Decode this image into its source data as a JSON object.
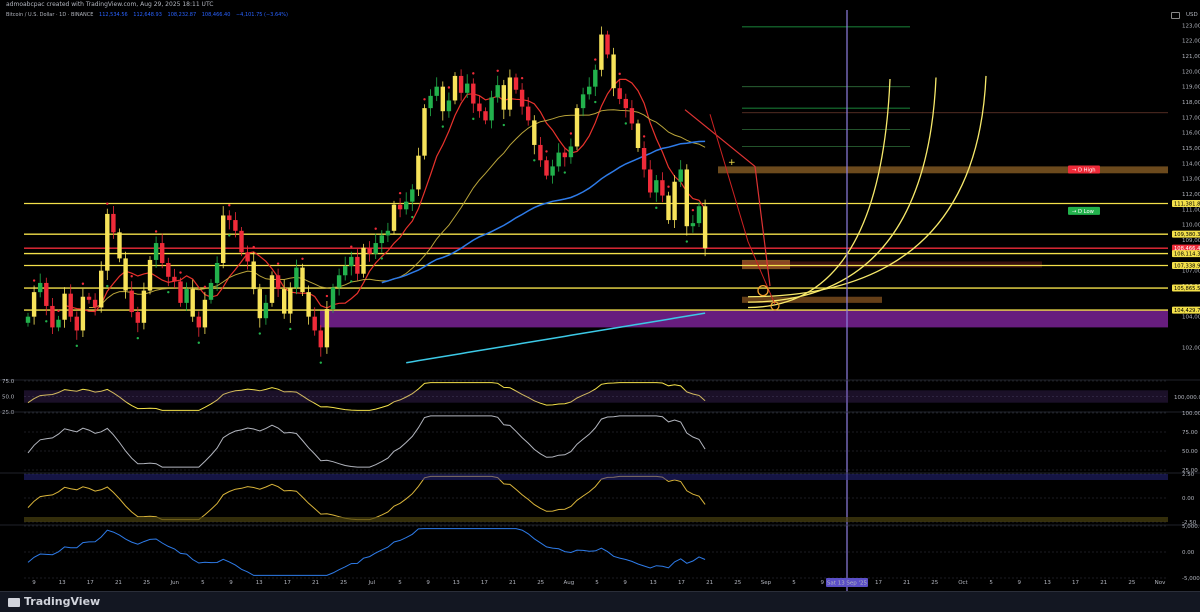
{
  "header": {
    "attribution": "admoabcpac created with TradingView.com, Aug 29, 2025 18:11 UTC",
    "symbol": "Bitcoin / U.S. Dollar · 1D · BINANCE",
    "ohlc": [
      "112,534.56",
      "112,648.93",
      "108,232.87",
      "108,466.40",
      "−4,101.75 (−3.64%)"
    ]
  },
  "footer": {
    "brand": "TradingView"
  },
  "colors": {
    "up": "#22b14c",
    "down": "#ef2b39",
    "doji": "#f7e35a",
    "level": "#f3e04a",
    "ma_fast": "#e8322c",
    "ma_mid": "#b9a43a",
    "ma_slow": "#2e7be8",
    "ma_cyan": "#3cc9e6",
    "fvg": "#8a27a8",
    "vline": "#8f7fe0",
    "red_tag": "#ef2b39",
    "green_tag": "#22b14c"
  },
  "chart_data": [
    {
      "type": "candlestick",
      "pane": "price",
      "currency": "USD",
      "ylim": [
        100000,
        124000
      ],
      "yticks": [
        "102,000.00",
        "104,000.00",
        "106,000.00",
        "107,000.00",
        "109,000.00",
        "110,000.00",
        "111,000.00",
        "112,000.00",
        "113,000.00",
        "114,000.00",
        "115,000.00",
        "116,000.00",
        "117,000.00",
        "118,000.00",
        "119,000.00",
        "120,000.00",
        "121,000.00",
        "122,000.00",
        "123,000.00"
      ],
      "x_ticks": [
        "9",
        "13",
        "17",
        "21",
        "25",
        "Jun",
        "5",
        "9",
        "13",
        "17",
        "21",
        "25",
        "Jul",
        "5",
        "9",
        "13",
        "17",
        "21",
        "25",
        "Aug",
        "5",
        "9",
        "13",
        "17",
        "21",
        "25",
        "Sep",
        "5",
        "9",
        "13",
        "17",
        "21",
        "25",
        "Oct",
        "5",
        "9",
        "13",
        "17",
        "21",
        "25",
        "Nov"
      ],
      "cursor_label": "Sat 13 Sep '25",
      "closes": [
        104000,
        105600,
        106200,
        104700,
        103300,
        103800,
        105500,
        104000,
        103100,
        105300,
        105100,
        104600,
        107000,
        110700,
        109500,
        107800,
        105700,
        104300,
        103600,
        105700,
        107700,
        108800,
        107500,
        106600,
        106300,
        104900,
        105800,
        104000,
        103300,
        105100,
        106200,
        107500,
        110600,
        110300,
        109600,
        108200,
        107600,
        105800,
        103900,
        104900,
        106700,
        105800,
        104200,
        105900,
        107200,
        105600,
        104000,
        103100,
        102000,
        104500,
        105900,
        106700,
        107300,
        107900,
        106800,
        108500,
        108100,
        108800,
        109300,
        109600,
        111300,
        111000,
        111500,
        112300,
        114500,
        117600,
        118400,
        119000,
        117400,
        118100,
        119700,
        118600,
        119200,
        117900,
        117400,
        116800,
        118300,
        119100,
        117500,
        119600,
        118800,
        117700,
        116800,
        115200,
        114200,
        113200,
        113800,
        114700,
        114400,
        115100,
        117600,
        118500,
        119000,
        120100,
        122400,
        121100,
        118900,
        118200,
        117600,
        116600,
        115000,
        113600,
        112100,
        112900,
        111900,
        110300,
        112800,
        113600,
        109900,
        110100,
        111200,
        108466
      ],
      "levels": [
        {
          "value": "111,381.85",
          "color": "#f3e04a"
        },
        {
          "value": "109,380.33",
          "color": "#f3e04a"
        },
        {
          "value": "108,466.40",
          "color": "#ef2b39"
        },
        {
          "value": "108,114.36",
          "color": "#f3e04a"
        },
        {
          "value": "107,338.94",
          "color": "#f3e04a"
        },
        {
          "value": "105,865.57",
          "color": "#f3e04a"
        },
        {
          "value": "104,429.77",
          "color": "#f3e04a"
        }
      ],
      "zone_tags": [
        {
          "label": "D High",
          "color": "#ef2b39"
        },
        {
          "label": "D Low",
          "color": "#22b14c"
        }
      ]
    },
    {
      "type": "line",
      "pane": "oscillator-1",
      "yticks": [
        "75.0",
        "50.0",
        "25.0"
      ],
      "right_label": "100,000.00"
    },
    {
      "type": "area",
      "pane": "oscillator-2",
      "yticks": [
        "100.00",
        "75.00",
        "50.00",
        "25.00"
      ]
    },
    {
      "type": "line",
      "pane": "oscillator-3",
      "yticks": [
        "2.50",
        "0.00",
        "-2.50"
      ]
    },
    {
      "type": "line",
      "pane": "oscillator-4",
      "yticks": [
        "5,000.00",
        "0.00",
        "-5,000.00"
      ]
    }
  ]
}
